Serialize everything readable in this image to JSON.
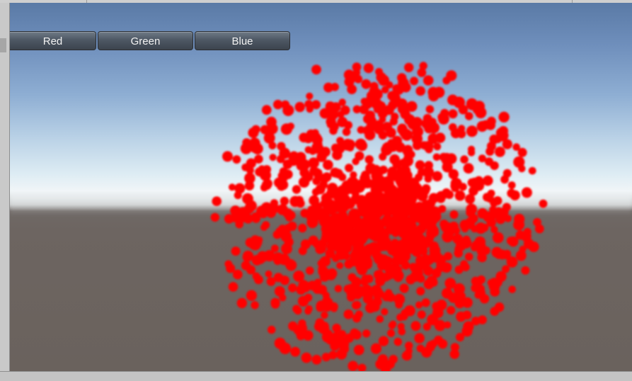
{
  "toolbar": {
    "buttons": [
      {
        "id": "red",
        "label": "Red"
      },
      {
        "id": "green",
        "label": "Green"
      },
      {
        "id": "blue",
        "label": "Blue"
      }
    ]
  },
  "scene": {
    "particle_color": "#ff0000",
    "sky_top_color": "#5a7aa6",
    "horizon_color": "#f1f6f8",
    "ground_color": "#6a625d"
  }
}
